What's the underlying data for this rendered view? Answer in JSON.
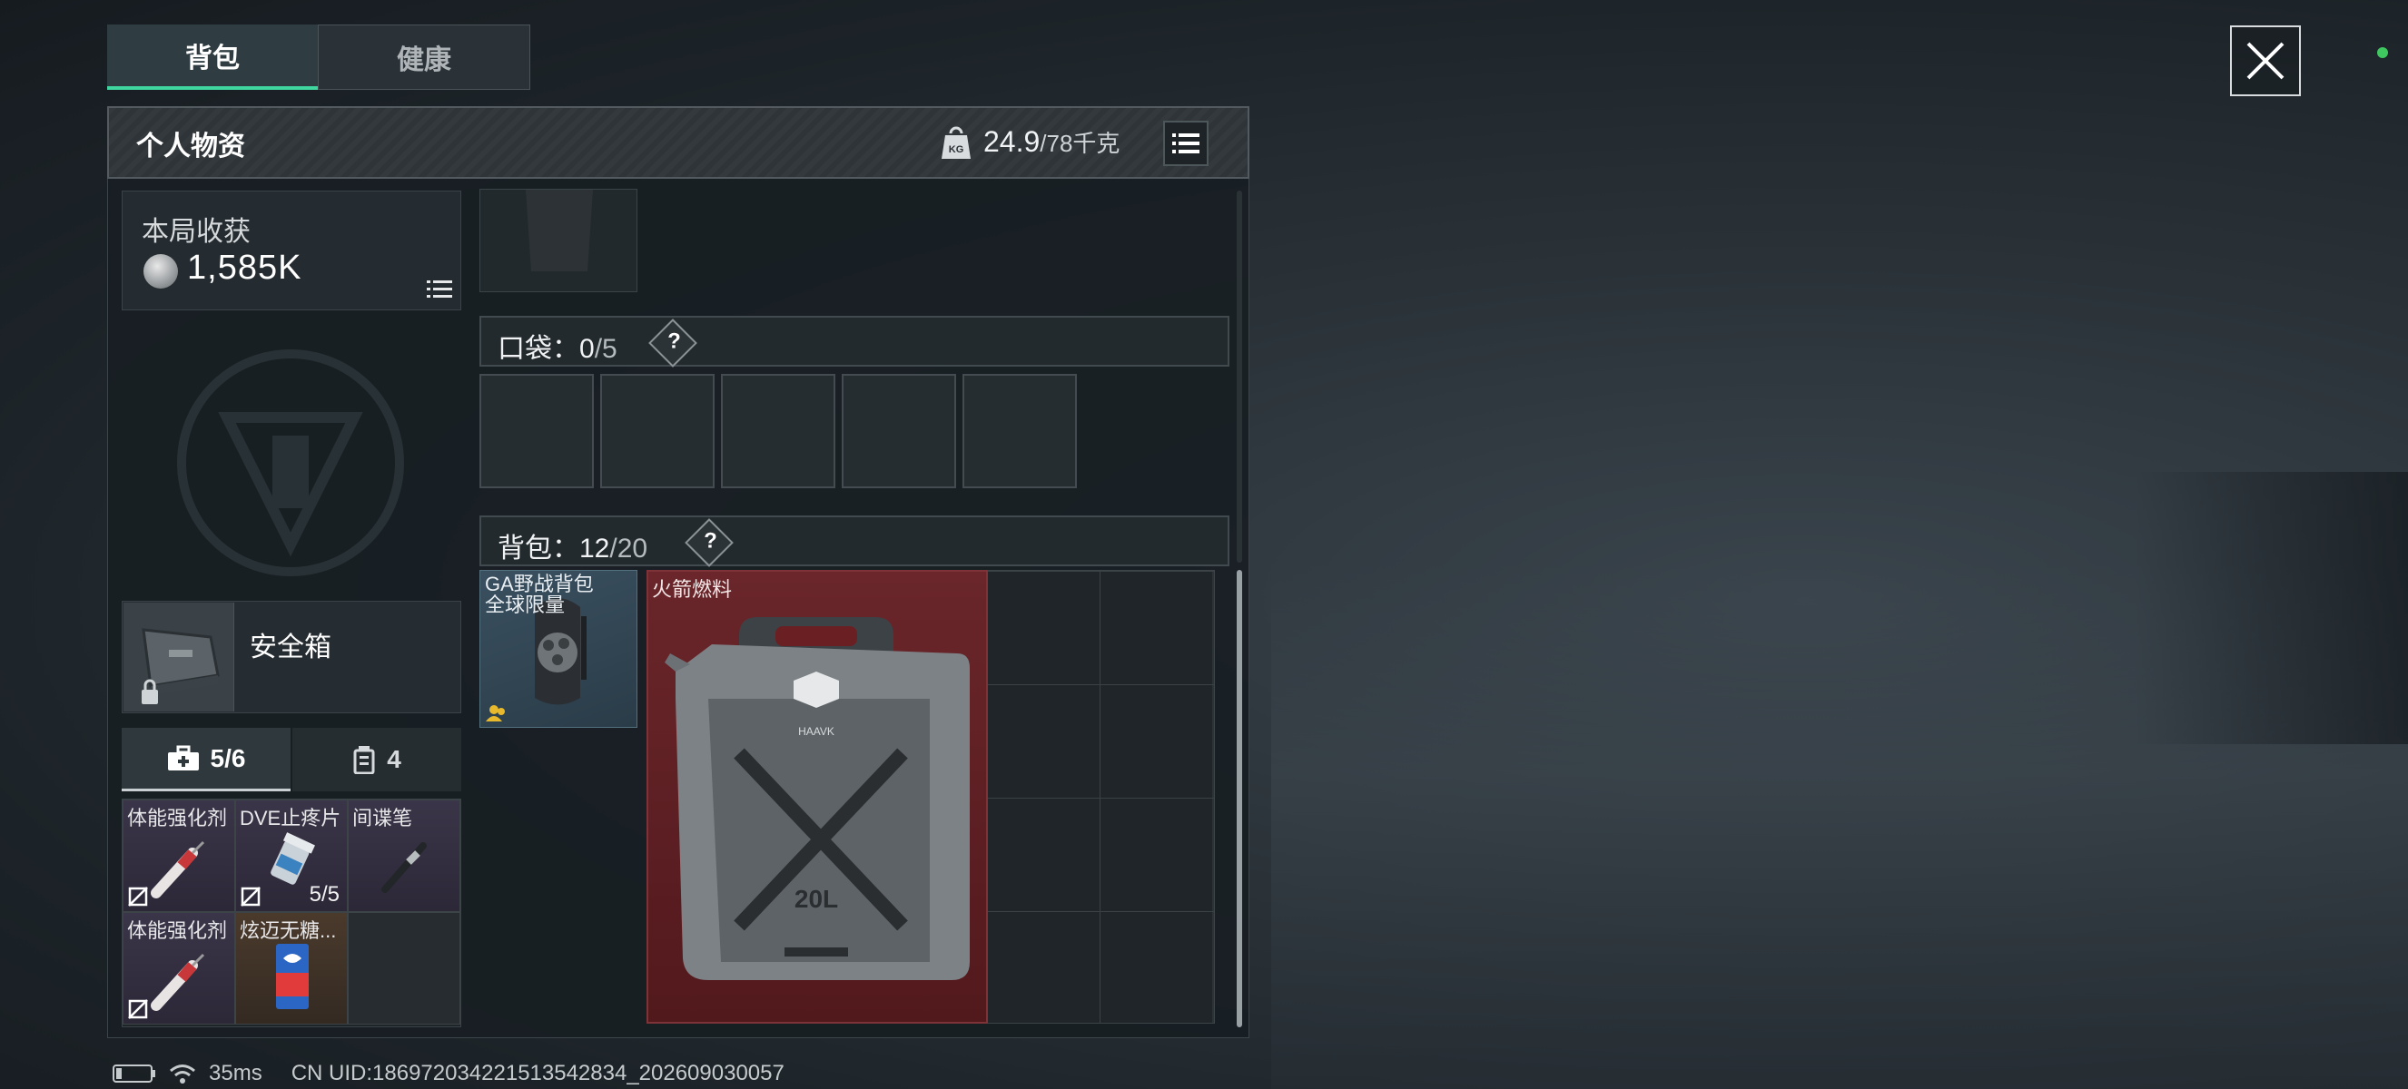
{
  "tabs": [
    {
      "label": "背包",
      "active": true
    },
    {
      "label": "健康",
      "active": false
    }
  ],
  "panel": {
    "title": "个人物资",
    "weight_current": "24.9",
    "weight_max": "/78千克",
    "weight_icon_text": "KG"
  },
  "harvest": {
    "label": "本局收获",
    "value": "1,585K"
  },
  "safebox": {
    "label": "安全箱"
  },
  "subtabs": [
    {
      "label": "5/6",
      "icon": "medkit-icon"
    },
    {
      "label": "4",
      "icon": "canister-icon"
    }
  ],
  "quick_items": [
    {
      "name": "体能强化剂",
      "count": "",
      "rarity": "purple"
    },
    {
      "name": "DVE止疼片",
      "count": "5/5",
      "rarity": "purple"
    },
    {
      "name": "间谍笔",
      "count": "",
      "rarity": "purple"
    },
    {
      "name": "体能强化剂",
      "count": "",
      "rarity": "purple"
    },
    {
      "name": "炫迈无糖...",
      "count": "",
      "rarity": "brown"
    }
  ],
  "pocket": {
    "label": "口袋：",
    "count": "0",
    "capacity": "/5",
    "help": "?"
  },
  "backpack": {
    "label": "背包：",
    "count": "12",
    "capacity": "/20",
    "help": "?"
  },
  "bag_items": [
    {
      "name_line1": "GA野战背包",
      "name_line2": "全球限量"
    },
    {
      "name": "火箭燃料",
      "can_brand": "HAAVK",
      "can_volume": "20L"
    }
  ],
  "status": {
    "ping": "35ms",
    "uid": "CN UID:186972034221513542834_202609030057"
  },
  "colors": {
    "accent_green": "#3fd6a0",
    "rare_red": "#6a262a",
    "epic_purple": "#3a3548",
    "uncommon_blue": "#3a5060",
    "online_dot": "#3ec85f"
  }
}
